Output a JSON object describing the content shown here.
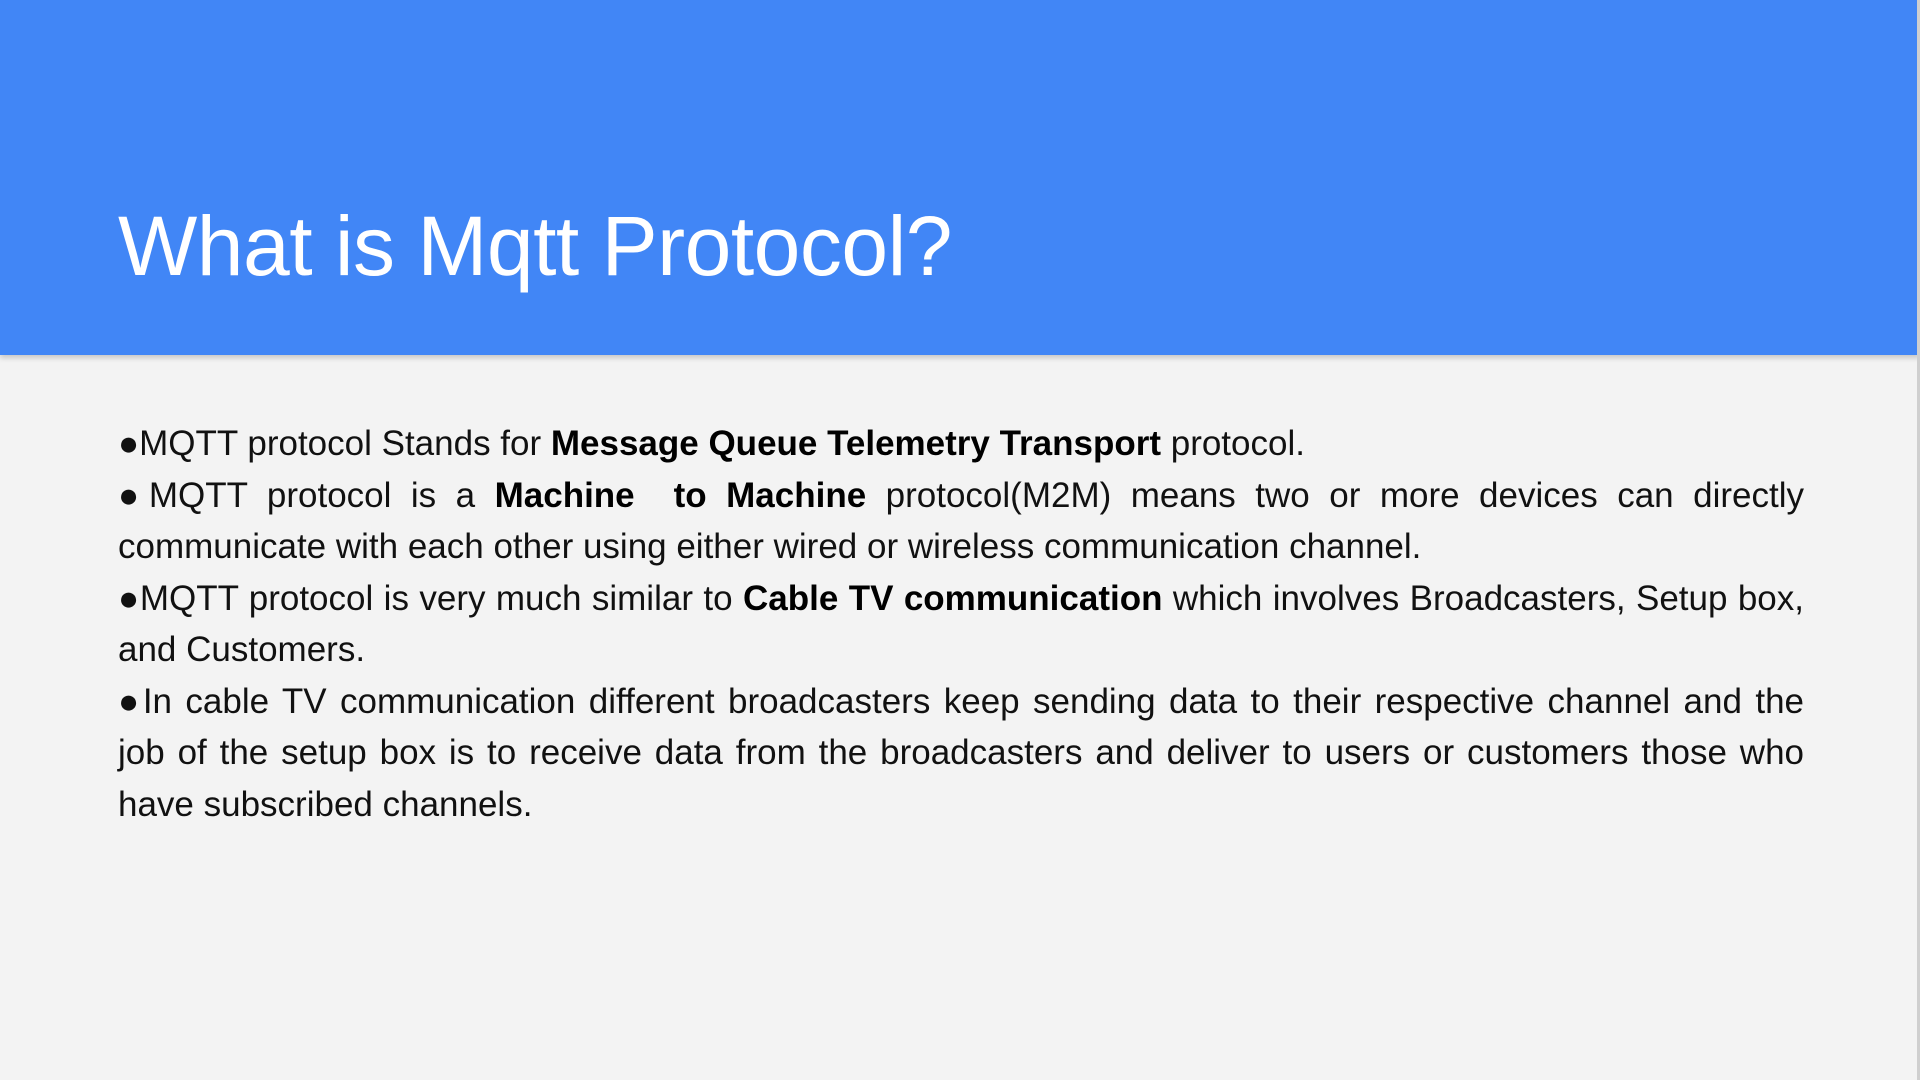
{
  "slide": {
    "title": "What is Mqtt Protocol?",
    "colors": {
      "header_background": "#4186f6",
      "title_text": "#ffffff",
      "body_background": "#f3f3f3",
      "body_text": "#111111"
    },
    "bullet_symbol": "●",
    "points": [
      {
        "lead": "MQTT protocol Stands for ",
        "bold": "Message Queue Telemetry Transport",
        "tail": " protocol."
      },
      {
        "lead": "MQTT protocol is a ",
        "bold": "Machine  to Machine",
        "tail": " protocol(M2M) means two or more devices can directly communicate with each other using either wired or wireless communication channel."
      },
      {
        "lead": "MQTT protocol is very much similar to ",
        "bold": "Cable TV communication",
        "tail": " which involves Broadcasters, Setup box, and Customers."
      },
      {
        "lead": "In cable TV communication different broadcasters keep sending data to their respective channel and the job of the setup box is to receive data from the broadcasters and deliver to users or customers those who have subscribed channels.",
        "bold": "",
        "tail": ""
      }
    ]
  }
}
